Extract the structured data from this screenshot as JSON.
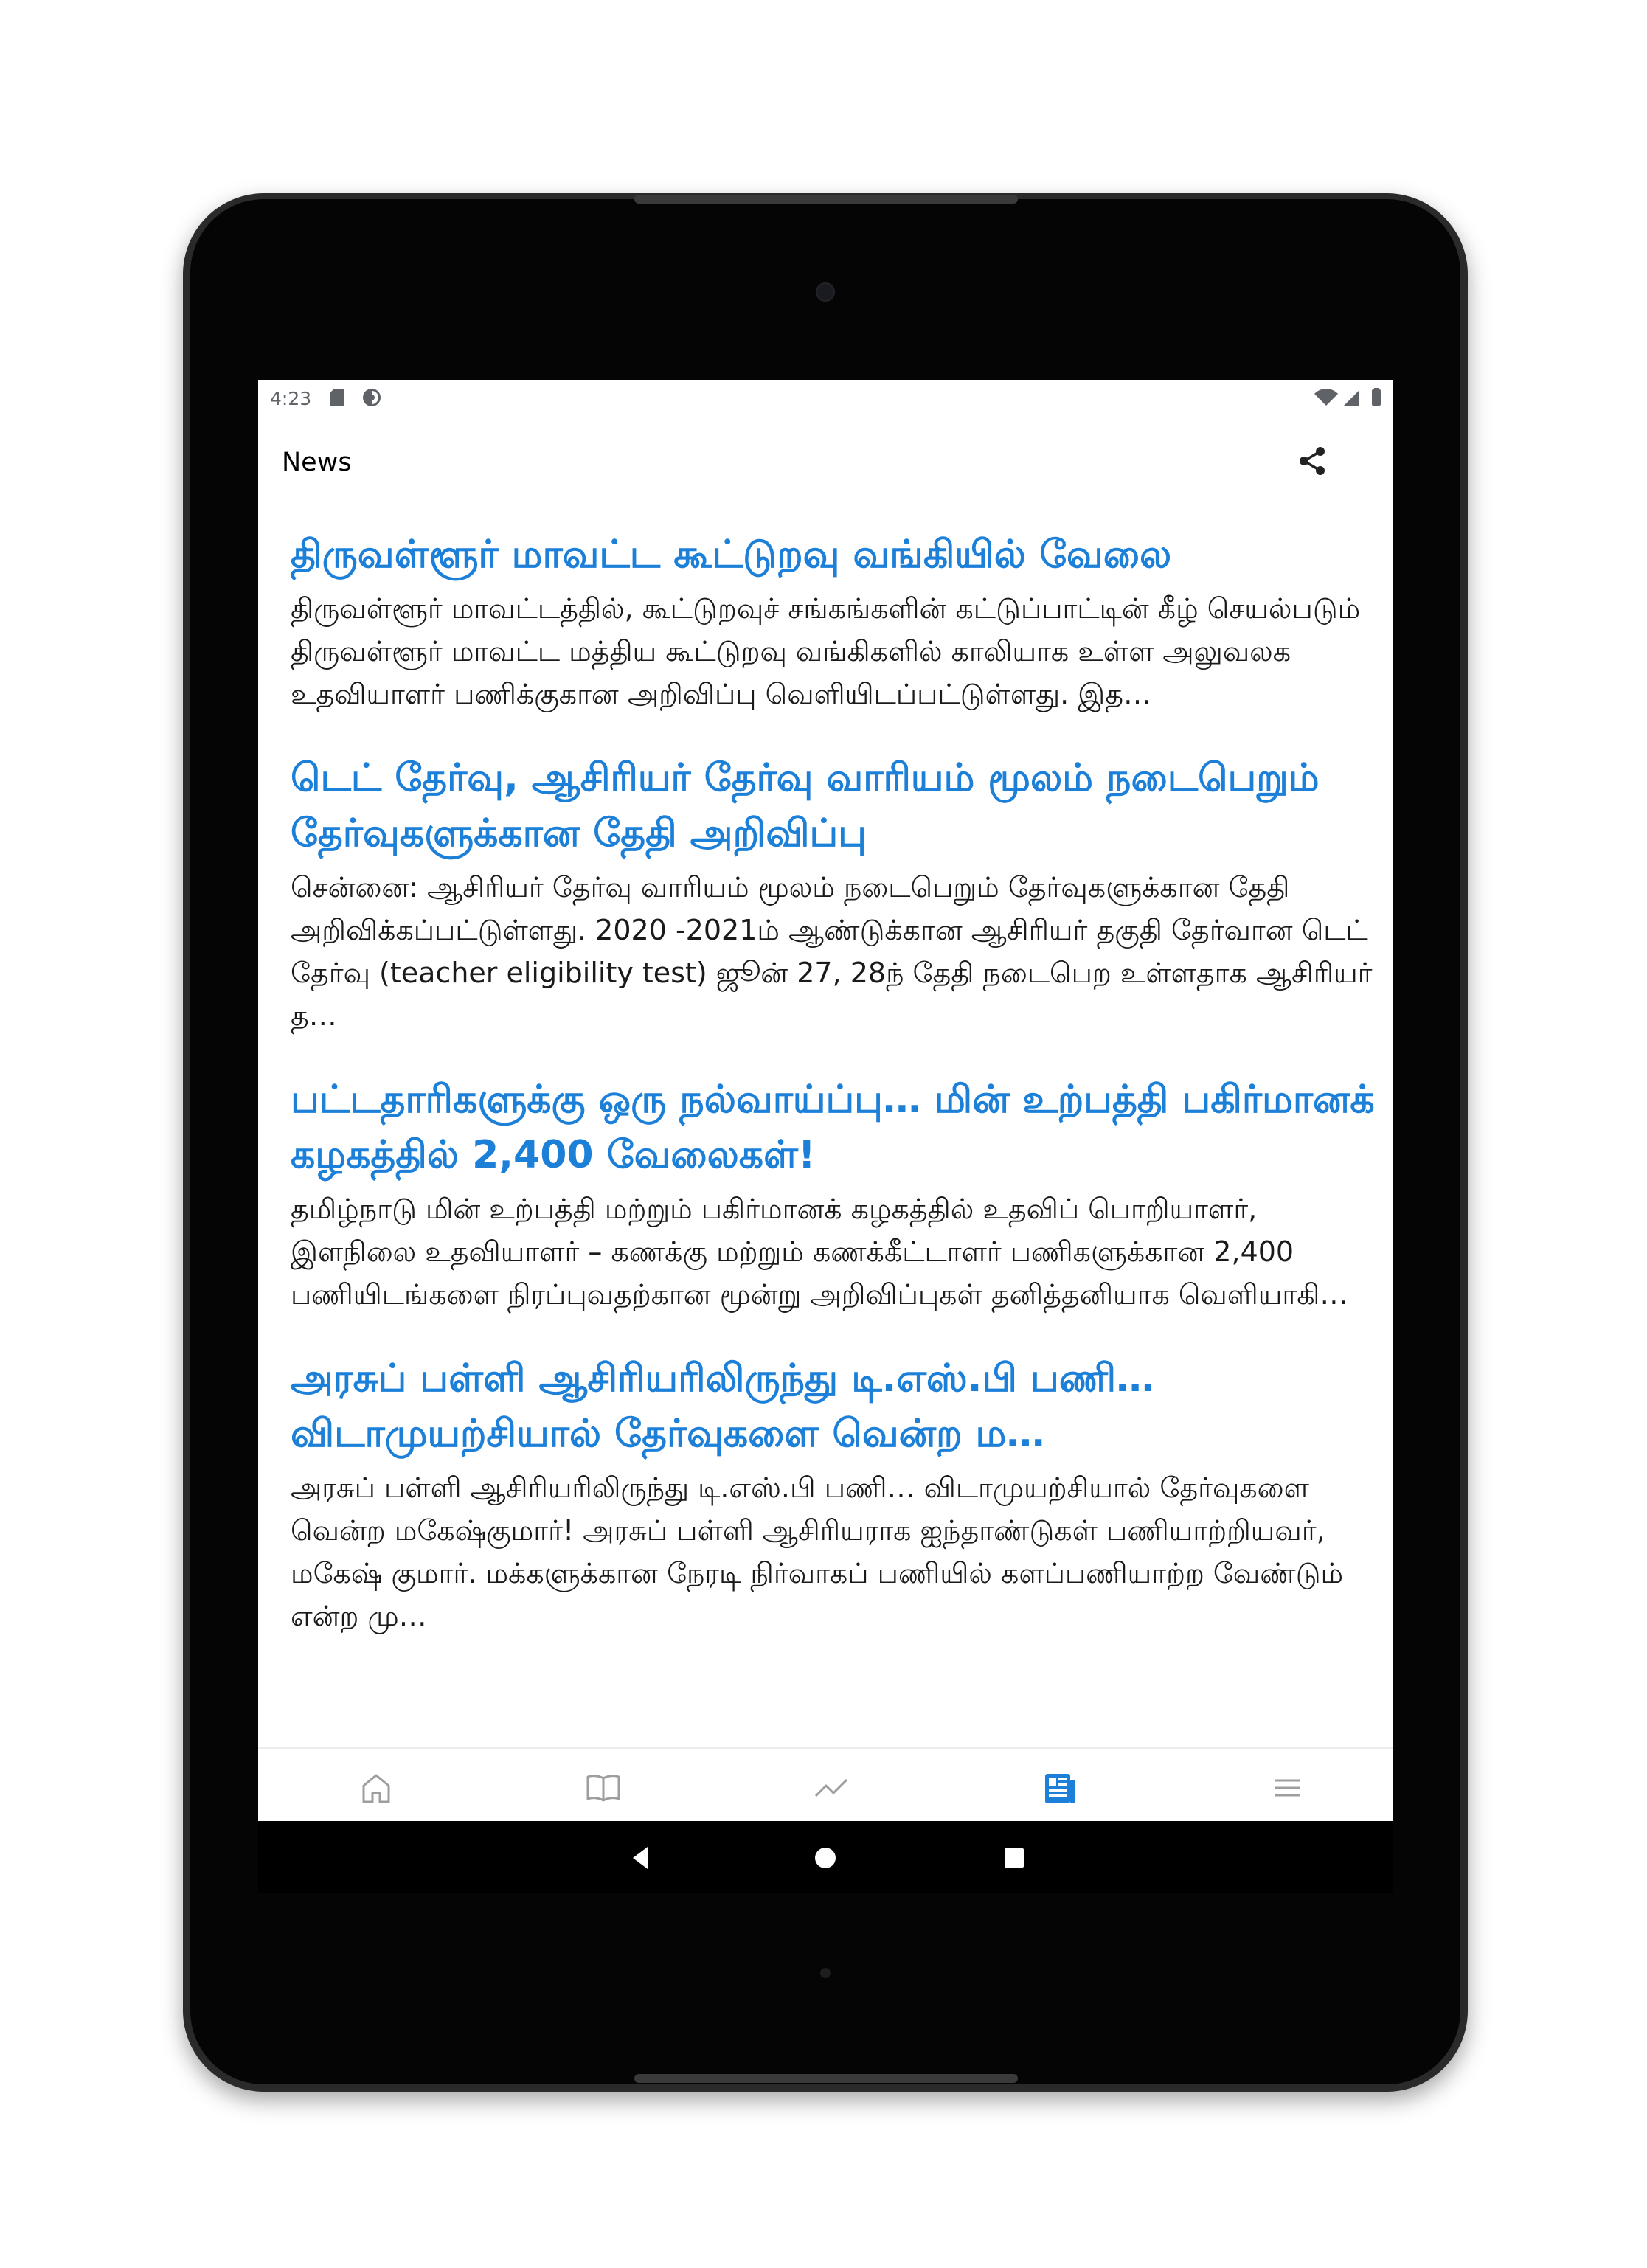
{
  "status_bar": {
    "time": "4:23",
    "left_icons": [
      "sd-card-icon",
      "vpn-icon"
    ],
    "right_icons": [
      "wifi-icon",
      "signal-icon",
      "battery-icon"
    ]
  },
  "app_bar": {
    "title": "News",
    "share_icon": "share-icon"
  },
  "news": [
    {
      "title": "திருவள்ளூர் மாவட்ட கூட்டுறவு வங்கியில் வேலை",
      "summary": "திருவள்ளூர் மாவட்டத்தில், கூட்டுறவுச் சங்கங்களின் கட்டுப்பாட்டின் கீழ் செயல்படும் திருவள்ளூர் மாவட்ட மத்திய கூட்டுறவு வங்கிகளில் காலியாக உள்ள அலுவலக உதவியாளர் பணிக்குகான அறிவிப்பு வெளியிடப்பட்டுள்ளது. இத…"
    },
    {
      "title": "டெட் தேர்வு, ஆசிரியர் தேர்வு வாரியம் மூலம் நடைபெறும் தேர்வுகளுக்கான தேதி அறிவிப்பு",
      "summary": "சென்னை: ஆசிரியர் தேர்வு வாரியம் மூலம் நடைபெறும் தேர்வுகளுக்கான தேதி அறிவிக்கப்பட்டுள்ளது. 2020 -2021ம் ஆண்டுக்கான ஆசிரியர் தகுதி தேர்வான டெட் தேர்வு (teacher eligibility test) ஜூன் 27, 28ந் தேதி நடைபெற உள்ளதாக ஆசிரியர் த…"
    },
    {
      "title": "பட்டதாரிகளுக்கு ஒரு நல்வாய்ப்பு… மின் உற்பத்தி பகிர்மானக் கழகத்தில் 2,400 வேலைகள்!",
      "summary": "தமிழ்நாடு மின் உற்பத்தி மற்றும் பகிர்மானக் கழகத்தில் உதவிப் பொறியாளர், இளநிலை உதவியாளர் – கணக்கு மற்றும் கணக்கீட்டாளர் பணிகளுக்கான 2,400 பணியிடங்களை நிரப்புவதற்கான மூன்று அறிவிப்புகள் தனித்தனியாக வெளியாகி…"
    },
    {
      "title": "அரசுப் பள்ளி ஆசிரியரிலிருந்து டி.எஸ்.பி பணி… விடாமுயற்சியால் தேர்வுகளை வென்ற ம…",
      "summary": "அரசுப் பள்ளி ஆசிரியரிலிருந்து டி.எஸ்.பி பணி… விடாமுயற்சியால் தேர்வுகளை வென்ற மகேஷ்குமார்! அரசுப் பள்ளி ஆசிரியராக ஐந்தாண்டுகள் பணியாற்றியவர், மகேஷ் குமார். மக்களுக்கான நேரடி நிர்வாகப் பணியில் களப்பணியாற்ற வேண்டும் என்ற மு…"
    }
  ],
  "bottom_nav": {
    "items": [
      "home-icon",
      "book-icon",
      "trending-icon",
      "news-icon",
      "menu-icon"
    ],
    "active": "news-icon",
    "active_color": "#1c7fd8",
    "inactive_color": "#9e9e9e"
  },
  "system_nav": [
    "back-icon",
    "home-circle-icon",
    "recents-icon"
  ],
  "colors": {
    "title_blue": "#1c7fd8",
    "body_text": "#1a1a1a"
  }
}
